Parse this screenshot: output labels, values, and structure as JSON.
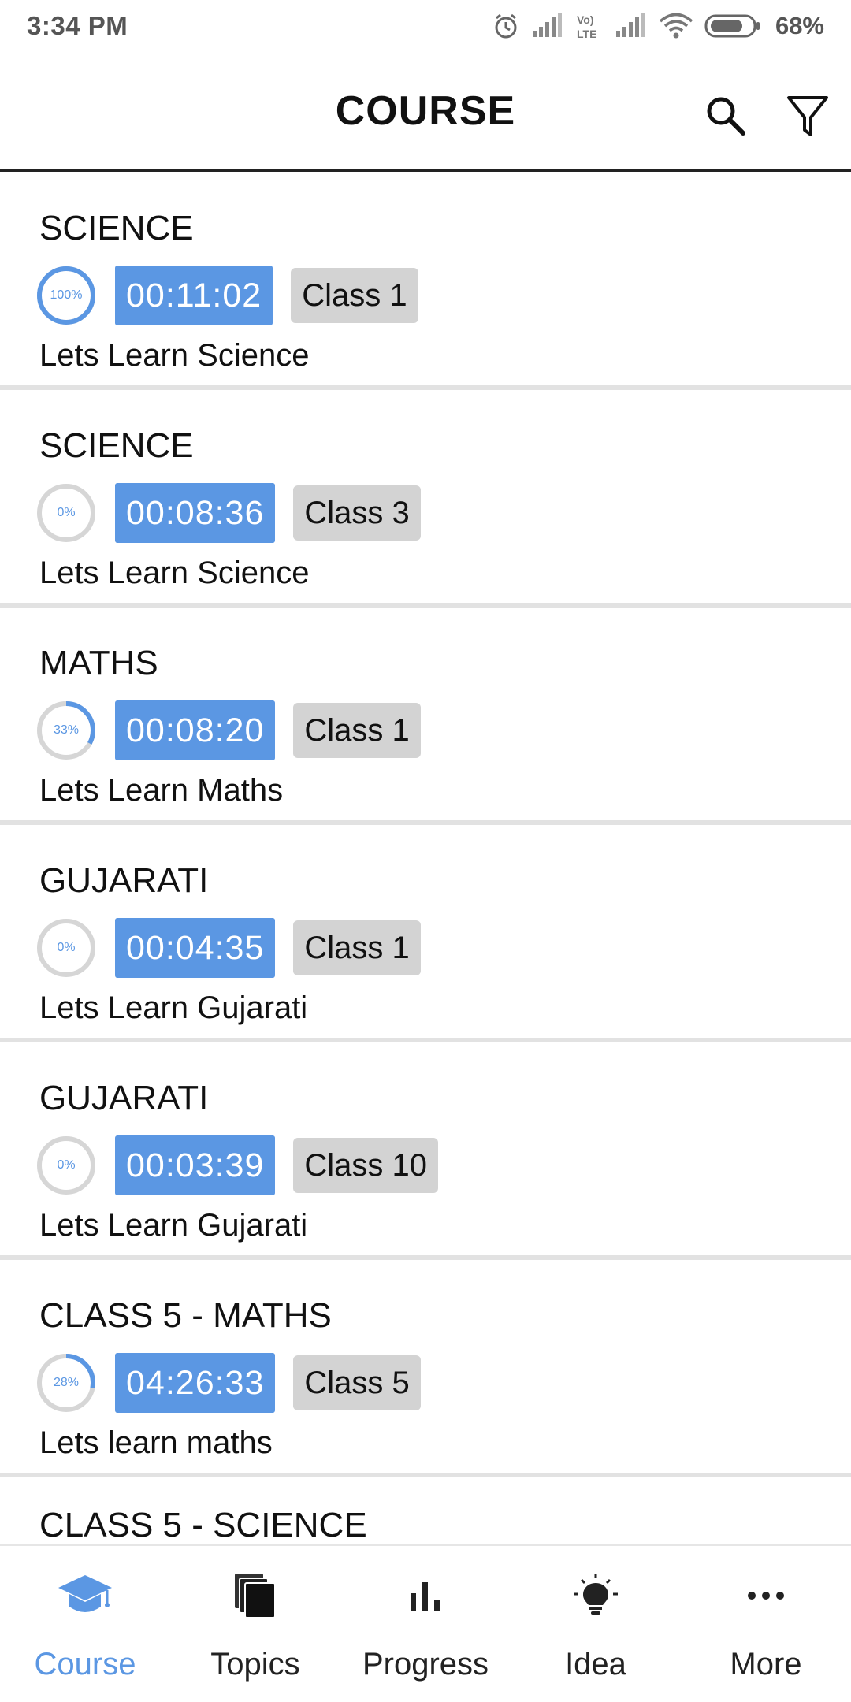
{
  "status_bar": {
    "time": "3:34 PM",
    "battery": "68%",
    "icons": [
      "alarm-icon",
      "signal-icon",
      "volte-icon",
      "signal-icon",
      "wifi-icon",
      "battery-icon"
    ]
  },
  "app_bar": {
    "title": "COURSE",
    "actions": [
      "search-icon",
      "filter-icon"
    ]
  },
  "courses": [
    {
      "subject": "SCIENCE",
      "progress": "100%",
      "progress_value": 1.0,
      "duration": "00:11:02",
      "class": "Class 1",
      "description": "Lets Learn Science"
    },
    {
      "subject": "SCIENCE",
      "progress": "0%",
      "progress_value": 0.0,
      "duration": "00:08:36",
      "class": "Class 3",
      "description": "Lets Learn Science"
    },
    {
      "subject": "MATHS",
      "progress": "33%",
      "progress_value": 0.33,
      "duration": "00:08:20",
      "class": "Class 1",
      "description": "Lets Learn Maths"
    },
    {
      "subject": "GUJARATI",
      "progress": "0%",
      "progress_value": 0.0,
      "duration": "00:04:35",
      "class": "Class 1",
      "description": "Lets Learn Gujarati"
    },
    {
      "subject": "GUJARATI",
      "progress": "0%",
      "progress_value": 0.0,
      "duration": "00:03:39",
      "class": "Class 10",
      "description": "Lets Learn Gujarati"
    },
    {
      "subject": "CLASS 5 - MATHS",
      "progress": "28%",
      "progress_value": 0.28,
      "duration": "04:26:33",
      "class": "Class 5",
      "description": "Lets learn maths"
    }
  ],
  "partial_course": {
    "subject": "CLASS 5 - SCIENCE"
  },
  "bottom_nav": [
    {
      "label": "Course",
      "icon": "graduation-cap-icon",
      "active": true
    },
    {
      "label": "Topics",
      "icon": "books-icon",
      "active": false
    },
    {
      "label": "Progress",
      "icon": "bar-chart-icon",
      "active": false
    },
    {
      "label": "Idea",
      "icon": "lightbulb-icon",
      "active": false
    },
    {
      "label": "More",
      "icon": "more-horizontal-icon",
      "active": false
    }
  ],
  "colors": {
    "accent": "#5b97e3",
    "badge_bg": "#d3d3d3",
    "ring_track": "#d6d6d6",
    "divider": "#e2e2e2"
  }
}
